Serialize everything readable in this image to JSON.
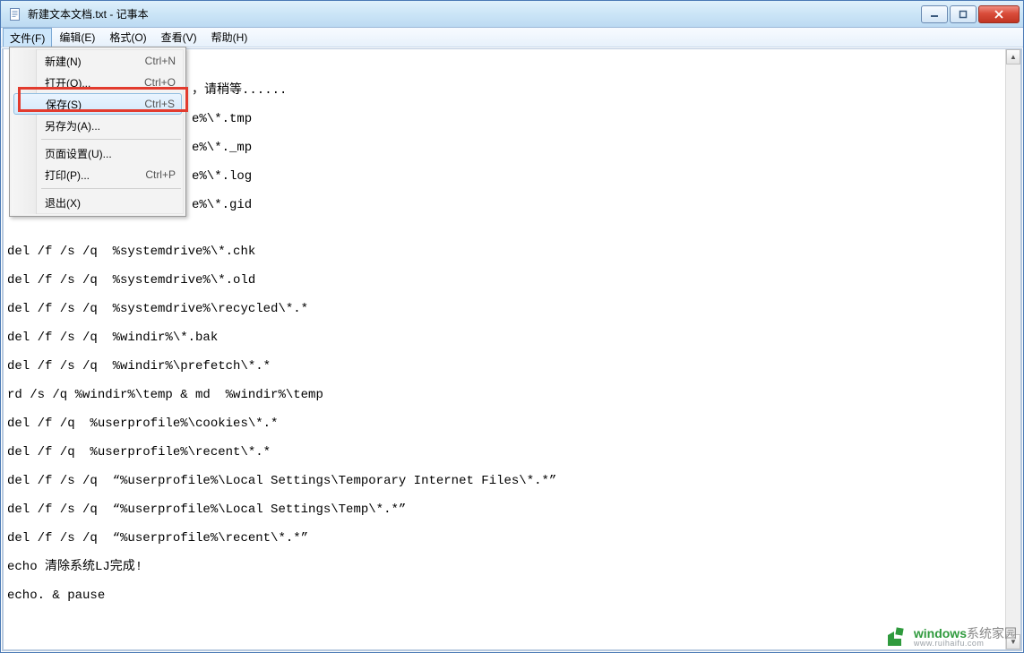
{
  "window": {
    "title": "新建文本文档.txt - 记事本"
  },
  "menubar": {
    "items": [
      {
        "label": "文件(F)",
        "open": true
      },
      {
        "label": "编辑(E)"
      },
      {
        "label": "格式(O)"
      },
      {
        "label": "查看(V)"
      },
      {
        "label": "帮助(H)"
      }
    ]
  },
  "dropdown": {
    "items": [
      {
        "label": "新建(N)",
        "shortcut": "Ctrl+N"
      },
      {
        "label": "打开(O)...",
        "shortcut": "Ctrl+O"
      },
      {
        "label": "保存(S)",
        "shortcut": "Ctrl+S",
        "hover": true,
        "highlight": true
      },
      {
        "label": "另存为(A)...",
        "shortcut": ""
      },
      {
        "sep": true
      },
      {
        "label": "页面设置(U)...",
        "shortcut": ""
      },
      {
        "label": "打印(P)...",
        "shortcut": "Ctrl+P"
      },
      {
        "sep": true
      },
      {
        "label": "退出(X)",
        "shortcut": ""
      }
    ]
  },
  "editor": {
    "visible_text_after_menu": [
      "，请稍等......",
      "",
      "e%\\*.tmp",
      "",
      "e%\\*._mp",
      "",
      "e%\\*.log",
      "",
      "e%\\*.gid"
    ],
    "lines": [
      "",
      "del /f /s /q  %systemdrive%\\*.chk",
      "",
      "del /f /s /q  %systemdrive%\\*.old",
      "",
      "del /f /s /q  %systemdrive%\\recycled\\*.*",
      "",
      "del /f /s /q  %windir%\\*.bak",
      "",
      "del /f /s /q  %windir%\\prefetch\\*.*",
      "",
      "rd /s /q %windir%\\temp & md  %windir%\\temp",
      "",
      "del /f /q  %userprofile%\\cookies\\*.*",
      "",
      "del /f /q  %userprofile%\\recent\\*.*",
      "",
      "del /f /s /q  “%userprofile%\\Local Settings\\Temporary Internet Files\\*.*”",
      "",
      "del /f /s /q  “%userprofile%\\Local Settings\\Temp\\*.*”",
      "",
      "del /f /s /q  “%userprofile%\\recent\\*.*”",
      "",
      "echo 清除系统LJ完成!",
      "",
      "echo. & pause"
    ]
  },
  "watermark": {
    "brand_green": "windows",
    "brand_grey": "系统家园",
    "url": "www.ruihaifu.com"
  }
}
